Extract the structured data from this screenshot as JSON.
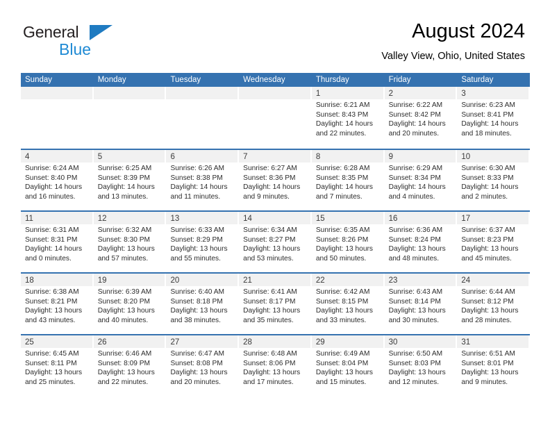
{
  "brand": {
    "name_top": "General",
    "name_bottom": "Blue",
    "triangle_icon": "blue-triangle-icon",
    "colors": {
      "top_text": "#231f20",
      "bottom_text": "#1f8ad4",
      "triangle": "#1f7bc1"
    }
  },
  "header": {
    "title": "August 2024",
    "subtitle": "Valley View, Ohio, United States"
  },
  "theme": {
    "header_row_bg": "#3572b0",
    "header_row_text": "#ffffff",
    "date_band_bg": "#f1f1f1",
    "row_separator": "#3572b0",
    "cell_bg": "#ffffff"
  },
  "calendar": {
    "weekday_headers": [
      "Sunday",
      "Monday",
      "Tuesday",
      "Wednesday",
      "Thursday",
      "Friday",
      "Saturday"
    ],
    "weeks": [
      [
        {
          "day": "",
          "sunrise": "",
          "sunset": "",
          "daylight_line1": "",
          "daylight_line2": "",
          "empty": true
        },
        {
          "day": "",
          "sunrise": "",
          "sunset": "",
          "daylight_line1": "",
          "daylight_line2": "",
          "empty": true
        },
        {
          "day": "",
          "sunrise": "",
          "sunset": "",
          "daylight_line1": "",
          "daylight_line2": "",
          "empty": true
        },
        {
          "day": "",
          "sunrise": "",
          "sunset": "",
          "daylight_line1": "",
          "daylight_line2": "",
          "empty": true
        },
        {
          "day": "1",
          "sunrise": "Sunrise: 6:21 AM",
          "sunset": "Sunset: 8:43 PM",
          "daylight_line1": "Daylight: 14 hours",
          "daylight_line2": "and 22 minutes.",
          "empty": false
        },
        {
          "day": "2",
          "sunrise": "Sunrise: 6:22 AM",
          "sunset": "Sunset: 8:42 PM",
          "daylight_line1": "Daylight: 14 hours",
          "daylight_line2": "and 20 minutes.",
          "empty": false
        },
        {
          "day": "3",
          "sunrise": "Sunrise: 6:23 AM",
          "sunset": "Sunset: 8:41 PM",
          "daylight_line1": "Daylight: 14 hours",
          "daylight_line2": "and 18 minutes.",
          "empty": false
        }
      ],
      [
        {
          "day": "4",
          "sunrise": "Sunrise: 6:24 AM",
          "sunset": "Sunset: 8:40 PM",
          "daylight_line1": "Daylight: 14 hours",
          "daylight_line2": "and 16 minutes.",
          "empty": false
        },
        {
          "day": "5",
          "sunrise": "Sunrise: 6:25 AM",
          "sunset": "Sunset: 8:39 PM",
          "daylight_line1": "Daylight: 14 hours",
          "daylight_line2": "and 13 minutes.",
          "empty": false
        },
        {
          "day": "6",
          "sunrise": "Sunrise: 6:26 AM",
          "sunset": "Sunset: 8:38 PM",
          "daylight_line1": "Daylight: 14 hours",
          "daylight_line2": "and 11 minutes.",
          "empty": false
        },
        {
          "day": "7",
          "sunrise": "Sunrise: 6:27 AM",
          "sunset": "Sunset: 8:36 PM",
          "daylight_line1": "Daylight: 14 hours",
          "daylight_line2": "and 9 minutes.",
          "empty": false
        },
        {
          "day": "8",
          "sunrise": "Sunrise: 6:28 AM",
          "sunset": "Sunset: 8:35 PM",
          "daylight_line1": "Daylight: 14 hours",
          "daylight_line2": "and 7 minutes.",
          "empty": false
        },
        {
          "day": "9",
          "sunrise": "Sunrise: 6:29 AM",
          "sunset": "Sunset: 8:34 PM",
          "daylight_line1": "Daylight: 14 hours",
          "daylight_line2": "and 4 minutes.",
          "empty": false
        },
        {
          "day": "10",
          "sunrise": "Sunrise: 6:30 AM",
          "sunset": "Sunset: 8:33 PM",
          "daylight_line1": "Daylight: 14 hours",
          "daylight_line2": "and 2 minutes.",
          "empty": false
        }
      ],
      [
        {
          "day": "11",
          "sunrise": "Sunrise: 6:31 AM",
          "sunset": "Sunset: 8:31 PM",
          "daylight_line1": "Daylight: 14 hours",
          "daylight_line2": "and 0 minutes.",
          "empty": false
        },
        {
          "day": "12",
          "sunrise": "Sunrise: 6:32 AM",
          "sunset": "Sunset: 8:30 PM",
          "daylight_line1": "Daylight: 13 hours",
          "daylight_line2": "and 57 minutes.",
          "empty": false
        },
        {
          "day": "13",
          "sunrise": "Sunrise: 6:33 AM",
          "sunset": "Sunset: 8:29 PM",
          "daylight_line1": "Daylight: 13 hours",
          "daylight_line2": "and 55 minutes.",
          "empty": false
        },
        {
          "day": "14",
          "sunrise": "Sunrise: 6:34 AM",
          "sunset": "Sunset: 8:27 PM",
          "daylight_line1": "Daylight: 13 hours",
          "daylight_line2": "and 53 minutes.",
          "empty": false
        },
        {
          "day": "15",
          "sunrise": "Sunrise: 6:35 AM",
          "sunset": "Sunset: 8:26 PM",
          "daylight_line1": "Daylight: 13 hours",
          "daylight_line2": "and 50 minutes.",
          "empty": false
        },
        {
          "day": "16",
          "sunrise": "Sunrise: 6:36 AM",
          "sunset": "Sunset: 8:24 PM",
          "daylight_line1": "Daylight: 13 hours",
          "daylight_line2": "and 48 minutes.",
          "empty": false
        },
        {
          "day": "17",
          "sunrise": "Sunrise: 6:37 AM",
          "sunset": "Sunset: 8:23 PM",
          "daylight_line1": "Daylight: 13 hours",
          "daylight_line2": "and 45 minutes.",
          "empty": false
        }
      ],
      [
        {
          "day": "18",
          "sunrise": "Sunrise: 6:38 AM",
          "sunset": "Sunset: 8:21 PM",
          "daylight_line1": "Daylight: 13 hours",
          "daylight_line2": "and 43 minutes.",
          "empty": false
        },
        {
          "day": "19",
          "sunrise": "Sunrise: 6:39 AM",
          "sunset": "Sunset: 8:20 PM",
          "daylight_line1": "Daylight: 13 hours",
          "daylight_line2": "and 40 minutes.",
          "empty": false
        },
        {
          "day": "20",
          "sunrise": "Sunrise: 6:40 AM",
          "sunset": "Sunset: 8:18 PM",
          "daylight_line1": "Daylight: 13 hours",
          "daylight_line2": "and 38 minutes.",
          "empty": false
        },
        {
          "day": "21",
          "sunrise": "Sunrise: 6:41 AM",
          "sunset": "Sunset: 8:17 PM",
          "daylight_line1": "Daylight: 13 hours",
          "daylight_line2": "and 35 minutes.",
          "empty": false
        },
        {
          "day": "22",
          "sunrise": "Sunrise: 6:42 AM",
          "sunset": "Sunset: 8:15 PM",
          "daylight_line1": "Daylight: 13 hours",
          "daylight_line2": "and 33 minutes.",
          "empty": false
        },
        {
          "day": "23",
          "sunrise": "Sunrise: 6:43 AM",
          "sunset": "Sunset: 8:14 PM",
          "daylight_line1": "Daylight: 13 hours",
          "daylight_line2": "and 30 minutes.",
          "empty": false
        },
        {
          "day": "24",
          "sunrise": "Sunrise: 6:44 AM",
          "sunset": "Sunset: 8:12 PM",
          "daylight_line1": "Daylight: 13 hours",
          "daylight_line2": "and 28 minutes.",
          "empty": false
        }
      ],
      [
        {
          "day": "25",
          "sunrise": "Sunrise: 6:45 AM",
          "sunset": "Sunset: 8:11 PM",
          "daylight_line1": "Daylight: 13 hours",
          "daylight_line2": "and 25 minutes.",
          "empty": false
        },
        {
          "day": "26",
          "sunrise": "Sunrise: 6:46 AM",
          "sunset": "Sunset: 8:09 PM",
          "daylight_line1": "Daylight: 13 hours",
          "daylight_line2": "and 22 minutes.",
          "empty": false
        },
        {
          "day": "27",
          "sunrise": "Sunrise: 6:47 AM",
          "sunset": "Sunset: 8:08 PM",
          "daylight_line1": "Daylight: 13 hours",
          "daylight_line2": "and 20 minutes.",
          "empty": false
        },
        {
          "day": "28",
          "sunrise": "Sunrise: 6:48 AM",
          "sunset": "Sunset: 8:06 PM",
          "daylight_line1": "Daylight: 13 hours",
          "daylight_line2": "and 17 minutes.",
          "empty": false
        },
        {
          "day": "29",
          "sunrise": "Sunrise: 6:49 AM",
          "sunset": "Sunset: 8:04 PM",
          "daylight_line1": "Daylight: 13 hours",
          "daylight_line2": "and 15 minutes.",
          "empty": false
        },
        {
          "day": "30",
          "sunrise": "Sunrise: 6:50 AM",
          "sunset": "Sunset: 8:03 PM",
          "daylight_line1": "Daylight: 13 hours",
          "daylight_line2": "and 12 minutes.",
          "empty": false
        },
        {
          "day": "31",
          "sunrise": "Sunrise: 6:51 AM",
          "sunset": "Sunset: 8:01 PM",
          "daylight_line1": "Daylight: 13 hours",
          "daylight_line2": "and 9 minutes.",
          "empty": false
        }
      ]
    ]
  }
}
